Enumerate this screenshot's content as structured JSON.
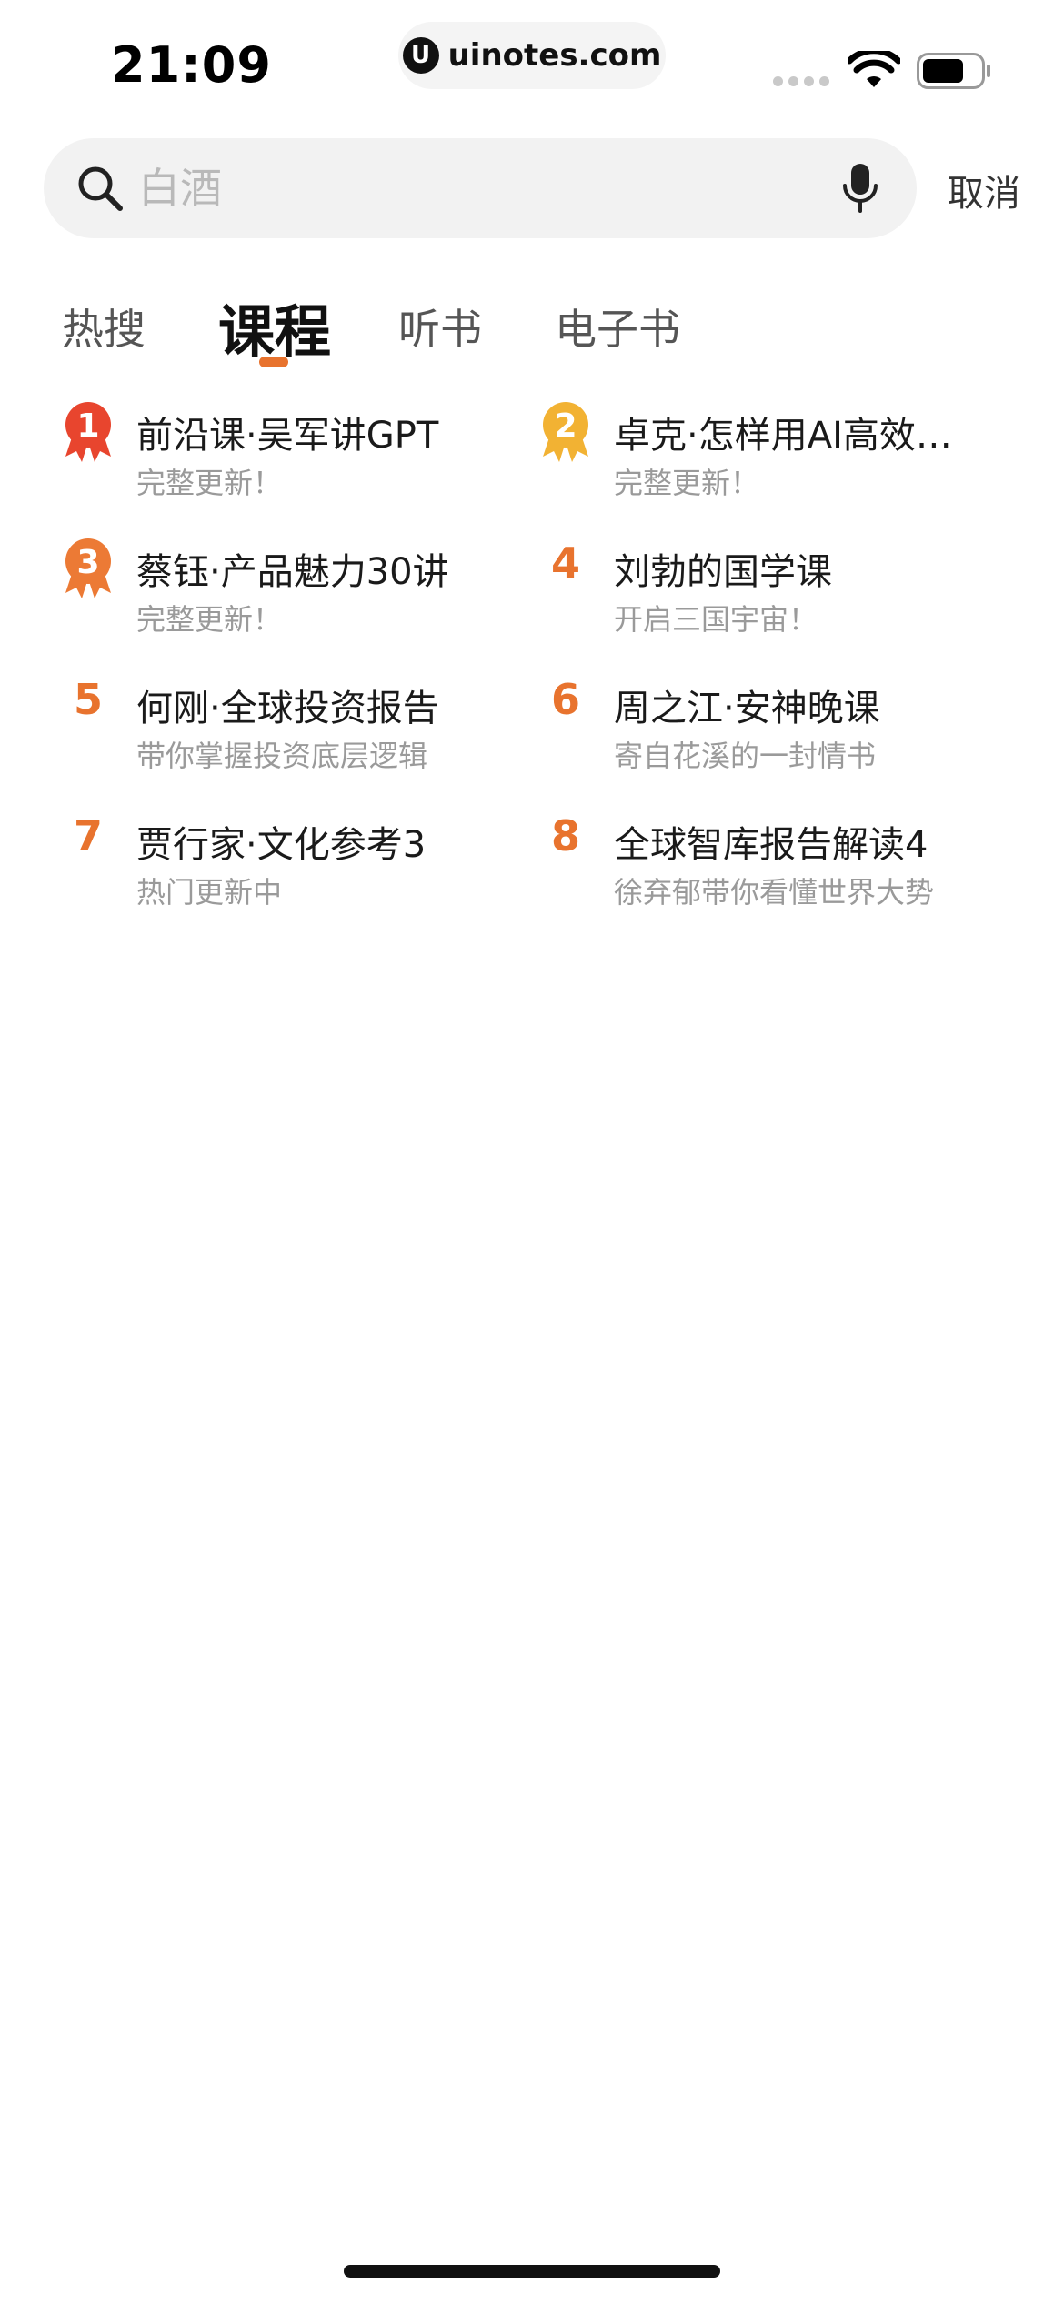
{
  "status_bar": {
    "time": "21:09",
    "url": "uinotes.com",
    "url_logo": "U"
  },
  "search": {
    "placeholder": "白酒",
    "value": "",
    "cancel_label": "取消"
  },
  "tabs": [
    {
      "label": "热搜",
      "active": false
    },
    {
      "label": "课程",
      "active": true
    },
    {
      "label": "听书",
      "active": false
    },
    {
      "label": "电子书",
      "active": false
    }
  ],
  "ranking": [
    {
      "rank": "1",
      "title": "前沿课·吴军讲GPT",
      "subtitle": "完整更新！"
    },
    {
      "rank": "2",
      "title": "卓克·怎样用AI高效…",
      "subtitle": "完整更新！"
    },
    {
      "rank": "3",
      "title": "蔡钰·产品魅力30讲",
      "subtitle": "完整更新！"
    },
    {
      "rank": "4",
      "title": "刘勃的国学课",
      "subtitle": "开启三国宇宙！"
    },
    {
      "rank": "5",
      "title": "何刚·全球投资报告",
      "subtitle": "带你掌握投资底层逻辑"
    },
    {
      "rank": "6",
      "title": "周之江·安神晚课",
      "subtitle": "寄自花溪的一封情书"
    },
    {
      "rank": "7",
      "title": "贾行家·文化参考3",
      "subtitle": "热门更新中"
    },
    {
      "rank": "8",
      "title": "全球智库报告解读4",
      "subtitle": "徐弃郁带你看懂世界大势"
    }
  ],
  "colors": {
    "accent": "#e8732e",
    "medal_gold": "#f2b233",
    "medal_red": "#e8452e",
    "medal_bronze": "#ec7a35",
    "subtitle": "#9a9a9a"
  },
  "icons": {
    "search": "search-icon",
    "mic": "mic-icon",
    "wifi": "wifi-icon",
    "battery": "battery-icon",
    "medal": "medal-icon"
  }
}
